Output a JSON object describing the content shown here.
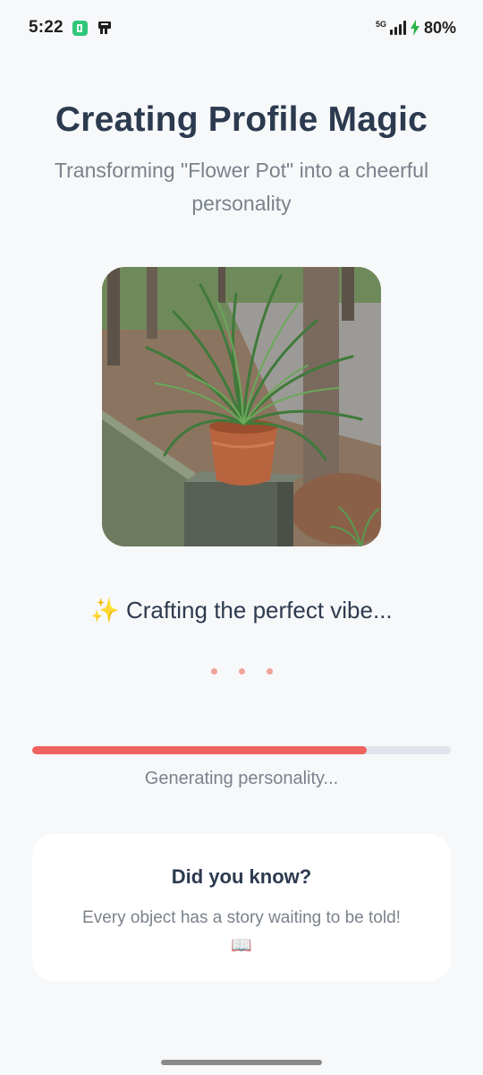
{
  "status_bar": {
    "time": "5:22",
    "network": "5G",
    "battery": "80%"
  },
  "header": {
    "title": "Creating Profile Magic",
    "subtitle": "Transforming \"Flower Pot\" into a cheerful personality"
  },
  "photo": {
    "subject": "potted plant on concrete pillar"
  },
  "status": {
    "spark_icon": "✨",
    "text": "Crafting the perfect vibe..."
  },
  "progress": {
    "value_percent": 80,
    "label": "Generating personality...",
    "fill_color": "#f0625f",
    "track_color": "#dfe4ec"
  },
  "fact_card": {
    "title": "Did you know?",
    "text": "Every object has a story waiting to be told!",
    "emoji": "📖"
  },
  "colors": {
    "background": "#f7f8fa",
    "accent": "#f0625f",
    "title": "#2c3a4f",
    "muted": "#7a828c"
  }
}
